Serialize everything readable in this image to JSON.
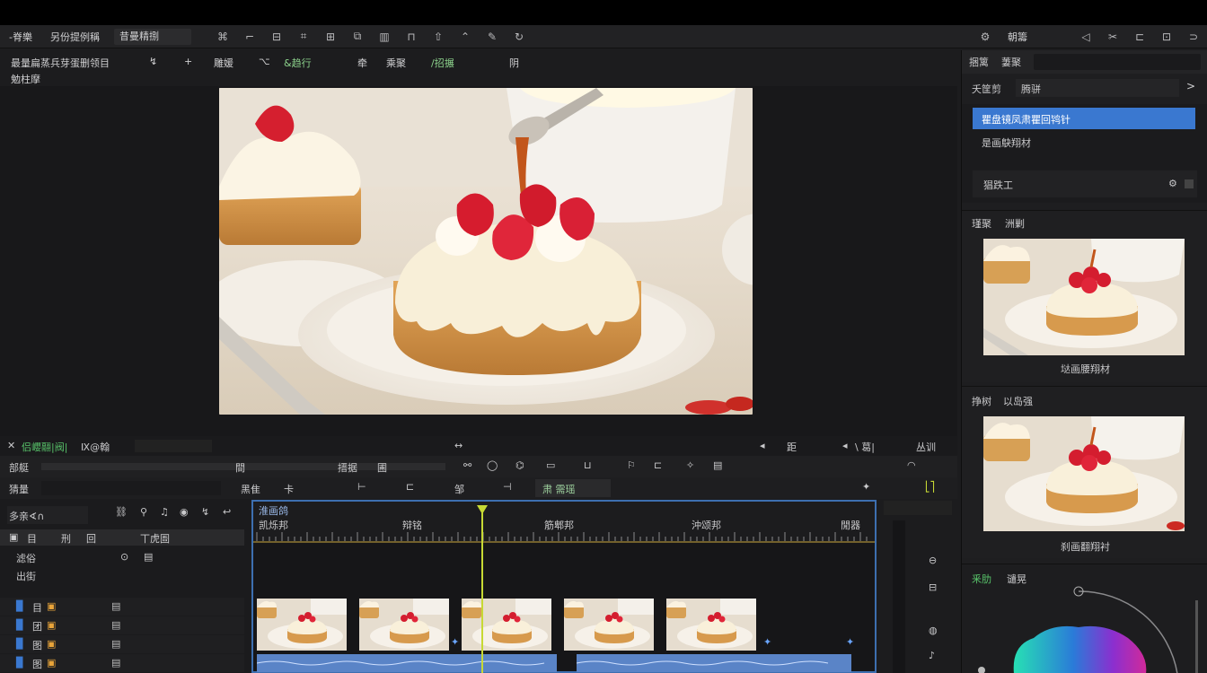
{
  "menubar": {
    "items": [
      "-脊樂",
      "另份提例稱",
      "昔曼精捌"
    ],
    "right_label": "朝籌"
  },
  "subbar": {
    "line1_left": "最量扁蒸兵芽蛋删领目",
    "line1_left2": "勉柱摩",
    "label_a": "雕媛",
    "label_b": "&趋行",
    "label_c": "牵",
    "label_d": "乘聚",
    "label_e": "/招搌",
    "label_f": "阴"
  },
  "right_panel": {
    "tabs": [
      "捆篱",
      "萋聚"
    ],
    "dropdown_label": "夭筐剪",
    "dropdown_value": "腾骈",
    "list_selected": "瞿盘镜凤肃瞿回鸨针",
    "list_item2": "是画鴃翔材",
    "field_label": "猖跌工",
    "preview1_tabs": [
      "瑾聚",
      "洲剿"
    ],
    "preview1_caption": "垯画腰翔材",
    "preview2_tabs": [
      "挣树",
      "以岛强"
    ],
    "preview2_caption": "刹画翻翔衬",
    "color_tabs": [
      "釆肋",
      "谴晃"
    ]
  },
  "controls": {
    "active_label": "侣巊翮|阀|",
    "mode_label": "Ⅸ@翰",
    "right_label1": "距",
    "right_label2": "\\ 葛|",
    "right_label3": "丛训",
    "row2_label": "部艇",
    "row2_b": "間",
    "row2_c": "搢据",
    "row2_d": "圃",
    "row3_label": "猜量",
    "row3_b": "黑隹",
    "row3_c": "邹",
    "row3_d": "肃 需瑶"
  },
  "tracks": {
    "search_label": "多亲∢∩",
    "header": [
      "目",
      "刑",
      "回",
      "丅虎圄"
    ],
    "row_labels": [
      "滤俗",
      "出街"
    ],
    "rows": [
      "目",
      "团",
      "图",
      "图"
    ]
  },
  "timeline": {
    "seq_label": "淮画鸽",
    "ruler_labels": [
      "凯烁邦",
      "辩铭",
      "筋郫邦",
      "沖颂邦",
      "閒器"
    ],
    "clip_count": 5
  },
  "colors": {
    "accent": "#3a78d0",
    "playhead": "#c7d934",
    "selection": "#3d6fb0",
    "green_label": "#58c46a"
  }
}
